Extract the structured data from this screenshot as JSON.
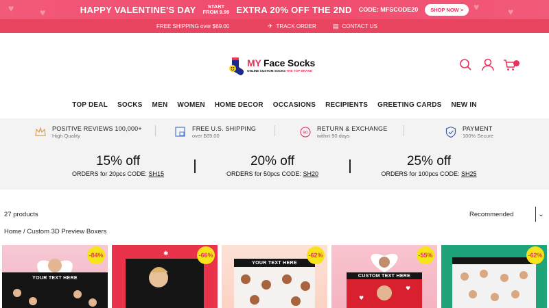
{
  "promo": {
    "headline": "HAPPY  VALENTINE'S DAY",
    "start_line1": "START",
    "start_line2": "FROM 9.99",
    "offer": "EXTRA 20% OFF THE 2ND",
    "code": "CODE: MFSCODE20",
    "shop_button": "SHOP NOW >",
    "bg_color": "#f25a7a"
  },
  "subbar": {
    "free_shipping": "FREE SHIPPING over $69.00",
    "track_order": "TRACK ORDER",
    "contact_us": "CONTACT US",
    "bg_color": "#e94560"
  },
  "header": {
    "logo_brand_my": "MY",
    "logo_brand_rest": " Face Socks",
    "logo_tagline": "ONLINE CUSTOM SOCKS",
    "logo_tagline_red": "THE TOP BRAND",
    "icons": [
      "search-icon",
      "user-icon",
      "cart-icon"
    ],
    "accent_color": "#e8325a"
  },
  "nav": {
    "items": [
      "TOP DEAL",
      "SOCKS",
      "MEN",
      "WOMEN",
      "HOME DECOR",
      "OCCASIONS",
      "RECIPIENTS",
      "GREETING CARDS",
      "NEW IN"
    ]
  },
  "benefits": [
    {
      "icon": "crown-icon",
      "title": "POSITIVE REVIEWS 100,000+",
      "sub": "High Quality"
    },
    {
      "icon": "shipping-box-icon",
      "title": "FREE U.S. SHIPPING",
      "sub": "over $69.00"
    },
    {
      "icon": "return-90-icon",
      "title": "RETURN & EXCHANGE",
      "sub": "within 90 days"
    },
    {
      "icon": "shield-check-icon",
      "title": "PAYMENT",
      "sub": "100% Secure"
    }
  ],
  "offers": [
    {
      "big": "15% off",
      "small_prefix": "ORDERS for 20pcs  CODE: ",
      "code": "SH15"
    },
    {
      "big": "20% off",
      "small_prefix": "ORDERS for 50pcs  CODE: ",
      "code": "SH20"
    },
    {
      "big": "25% off",
      "small_prefix": "ORDERS for 100pcs  CODE: ",
      "code": "SH25"
    }
  ],
  "listing": {
    "count": "27 products",
    "sort_value": "Recommended",
    "breadcrumb": "Home / Custom 3D Preview Boxers"
  },
  "products": [
    {
      "badge": "-84%",
      "label": "YOUR TEXT HERE"
    },
    {
      "badge": "-66%",
      "label": ""
    },
    {
      "badge": "-62%",
      "label": "YOUR TEXT HERE"
    },
    {
      "badge": "-55%",
      "label": "CUSTOM TEXT HERE"
    },
    {
      "badge": "-62%",
      "label": ""
    }
  ]
}
